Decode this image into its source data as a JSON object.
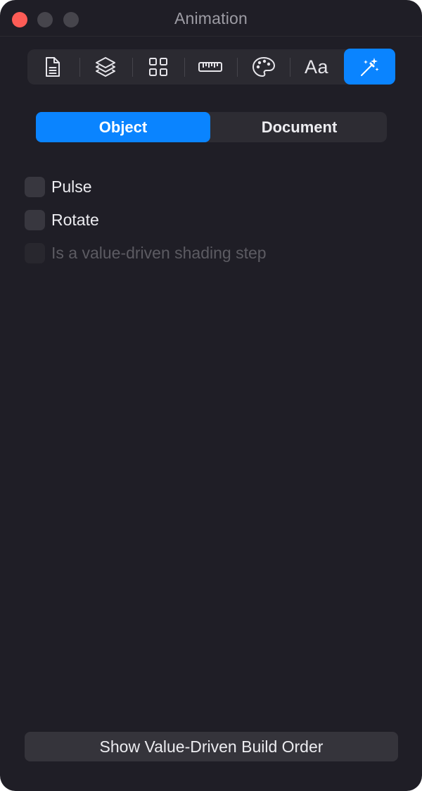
{
  "window": {
    "title": "Animation"
  },
  "toolbar": {
    "items": [
      {
        "icon": "document-icon",
        "active": false
      },
      {
        "icon": "layers-icon",
        "active": false
      },
      {
        "icon": "grid-icon",
        "active": false
      },
      {
        "icon": "ruler-icon",
        "active": false
      },
      {
        "icon": "palette-icon",
        "active": false
      },
      {
        "icon": "text-format-icon",
        "label": "Aa",
        "active": false
      },
      {
        "icon": "magic-wand-icon",
        "active": true
      }
    ]
  },
  "segments": {
    "object": "Object",
    "document": "Document",
    "selected": "Object"
  },
  "options": {
    "pulse": {
      "label": "Pulse",
      "checked": false,
      "enabled": true
    },
    "rotate": {
      "label": "Rotate",
      "checked": false,
      "enabled": true
    },
    "shading_step": {
      "label": "Is a value-driven shading step",
      "checked": false,
      "enabled": false
    }
  },
  "footer": {
    "build_order_button": "Show Value-Driven Build Order"
  },
  "colors": {
    "accent": "#0a84ff",
    "background": "#1f1e26",
    "close_button": "#fd5c56"
  }
}
